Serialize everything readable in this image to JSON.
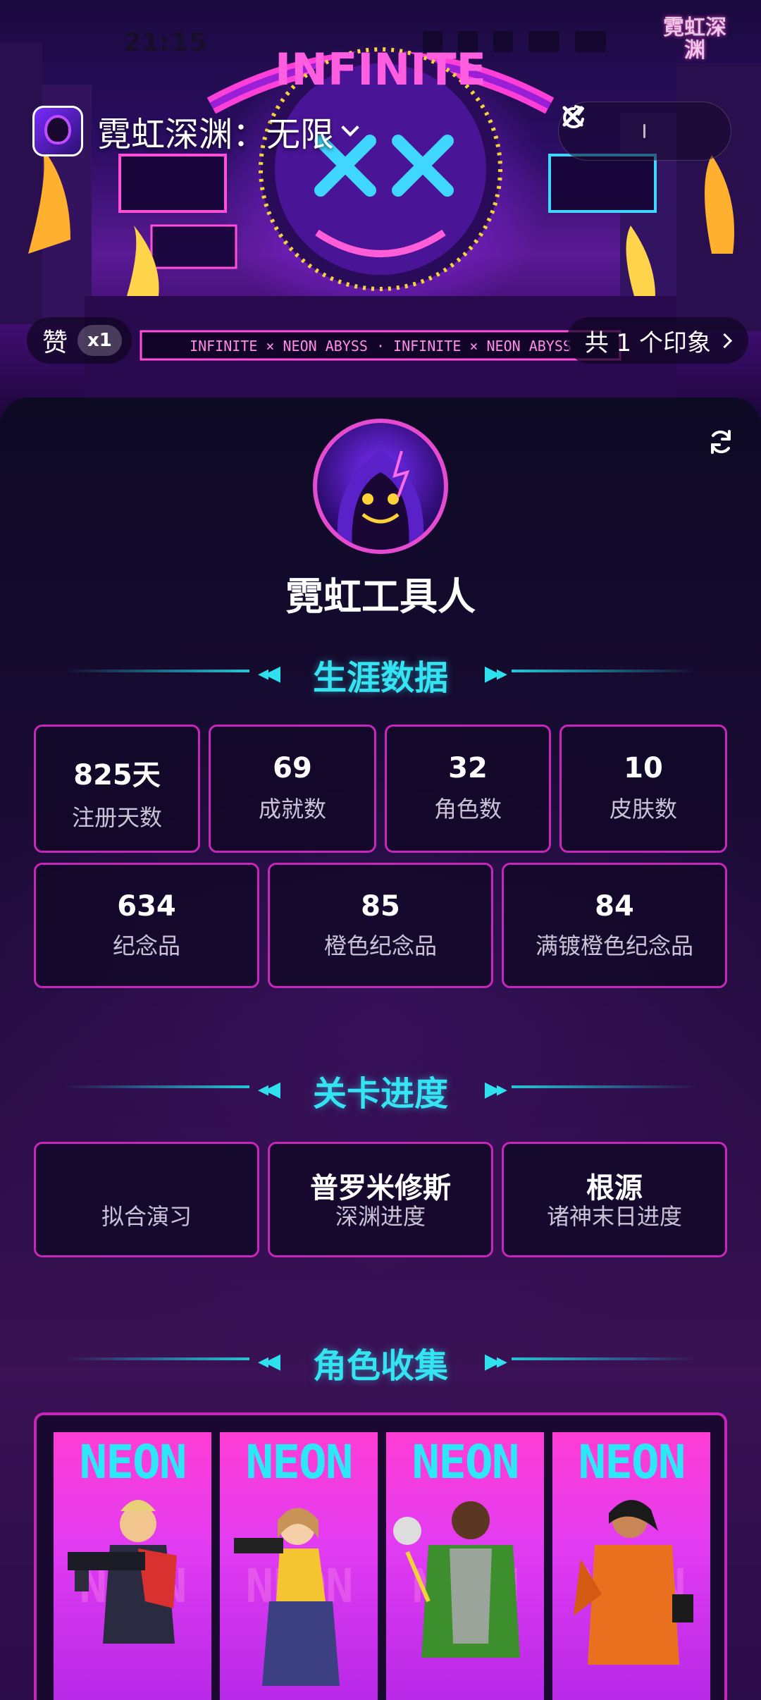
{
  "status_bar": {
    "time": "21:15",
    "watermark": "霓虹深渊"
  },
  "hero": {
    "banner_text": "INFINITE",
    "stage_text": "INFINITE × NEON ABYSS · INFINITE × NEON ABYSS"
  },
  "header": {
    "app_title": "霓虹深渊：无限"
  },
  "likes": {
    "label": "赞",
    "count": "x1"
  },
  "impressions": {
    "label": "共 1 个印象"
  },
  "profile": {
    "nickname": "霓虹工具人"
  },
  "career": {
    "title": "生涯数据",
    "stats_row1": [
      {
        "value": "825天",
        "label": "注册天数"
      },
      {
        "value": "69",
        "label": "成就数"
      },
      {
        "value": "32",
        "label": "角色数"
      },
      {
        "value": "10",
        "label": "皮肤数"
      }
    ],
    "stats_row2": [
      {
        "value": "634",
        "label": "纪念品"
      },
      {
        "value": "85",
        "label": "橙色纪念品"
      },
      {
        "value": "84",
        "label": "满镀橙色纪念品"
      }
    ]
  },
  "progress": {
    "title": "关卡进度",
    "items": [
      {
        "value": "",
        "label": "拟合演习"
      },
      {
        "value": "普罗米修斯",
        "label": "深渊进度"
      },
      {
        "value": "根源",
        "label": "诸神末日进度"
      }
    ]
  },
  "collection": {
    "title": "角色收集",
    "card_text": "NEON",
    "card_count": 4
  },
  "colors": {
    "accent_cyan": "#35e4f2",
    "card_border": "#c726bb",
    "panel_bg": "#190b34"
  }
}
